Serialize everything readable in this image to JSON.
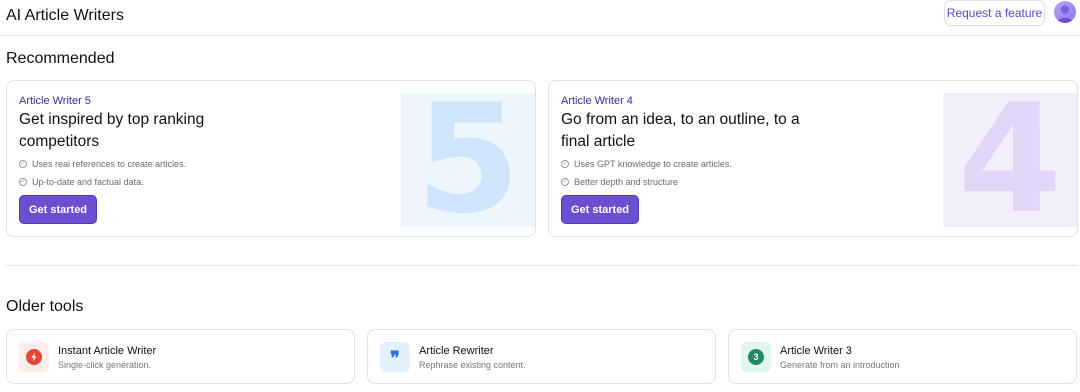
{
  "header": {
    "title": "AI Article Writers",
    "request_feature_label": "Request a feature"
  },
  "recommended": {
    "section_title": "Recommended",
    "cards": [
      {
        "eyebrow": "Article Writer 5",
        "headline": "Get inspired by top ranking competitors",
        "bullets": [
          "Uses real references to create articles.",
          "Up-to-date and factual data."
        ],
        "cta_label": "Get started",
        "hero_number": "5"
      },
      {
        "eyebrow": "Article Writer 4",
        "headline": "Go from an idea, to an outline, to a final article",
        "bullets": [
          "Uses GPT knowledge to create articles.",
          "Better depth and structure"
        ],
        "cta_label": "Get started",
        "hero_number": "4"
      }
    ]
  },
  "older_tools": {
    "section_title": "Older tools",
    "tools": [
      {
        "name": "Instant Article Writer",
        "description": "Single-click generation.",
        "icon": "lightning-bolt-icon"
      },
      {
        "name": "Article Rewriter",
        "description": "Rephrase existing content.",
        "icon": "quote-icon"
      },
      {
        "name": "Article Writer 3",
        "description": "Generate from an introduction",
        "icon": "number-3-icon",
        "icon_text": "3"
      }
    ]
  },
  "colors": {
    "accent": "#6b4fd0",
    "eyebrow": "#3b2c91",
    "hero_blue": "#cfe5fb",
    "hero_purple": "#e1d5f8"
  }
}
